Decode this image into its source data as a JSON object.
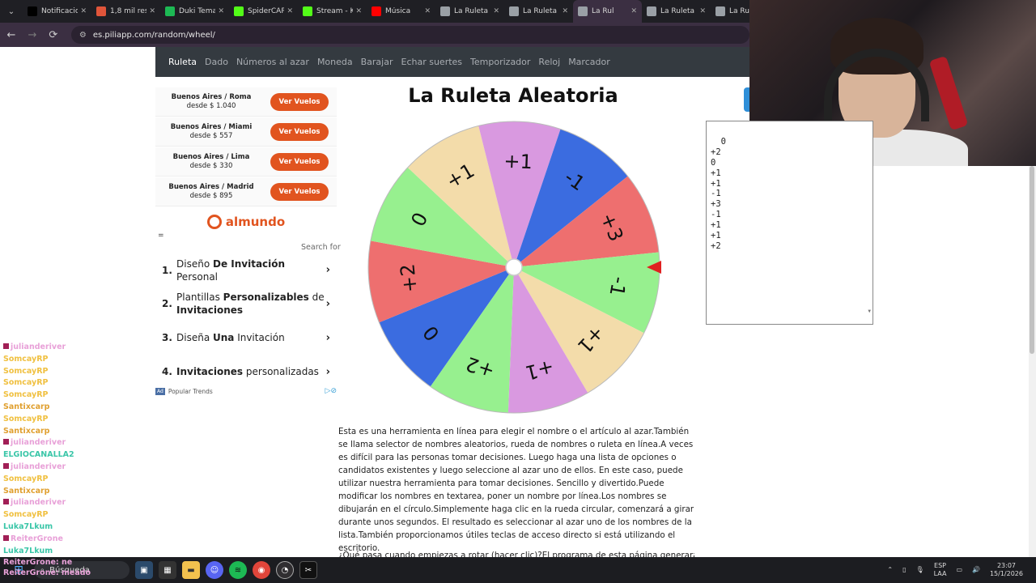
{
  "browser": {
    "tabs": [
      {
        "title": "Notificacio",
        "icon": "x-logo-icon",
        "color": "#000000"
      },
      {
        "title": "1,8 mil res",
        "icon": "bookmark-icon",
        "color": "#e0553a"
      },
      {
        "title": "Duki Tema",
        "icon": "spotify-icon",
        "color": "#1db954"
      },
      {
        "title": "SpiderCAR",
        "icon": "kick-icon",
        "color": "#53fc18"
      },
      {
        "title": "Stream - K",
        "icon": "kick-icon",
        "color": "#53fc18"
      },
      {
        "title": "Música",
        "icon": "youtube-icon",
        "color": "#ff0000"
      },
      {
        "title": "La Ruleta A",
        "icon": "globe-icon",
        "color": "#9aa0a6"
      },
      {
        "title": "La Ruleta A",
        "icon": "globe-icon",
        "color": "#9aa0a6"
      },
      {
        "title": "La Rul",
        "icon": "globe-icon",
        "color": "#9aa0a6",
        "active": true
      },
      {
        "title": "La Ruleta A",
        "icon": "globe-icon",
        "color": "#9aa0a6"
      },
      {
        "title": "La Rule",
        "icon": "globe-icon",
        "color": "#9aa0a6"
      }
    ],
    "url": "es.piliapp.com/random/wheel/"
  },
  "site_nav": [
    "Ruleta",
    "Dado",
    "Números al azar",
    "Moneda",
    "Barajar",
    "Echar suertes",
    "Temporizador",
    "Reloj",
    "Marcador"
  ],
  "ads": {
    "flights": [
      {
        "route": "Buenos Aires / Roma",
        "price": "desde $ 1.040",
        "button": "Ver Vuelos"
      },
      {
        "route": "Buenos Aires / Miami",
        "price": "desde $ 557",
        "button": "Ver Vuelos"
      },
      {
        "route": "Buenos Aires / Lima",
        "price": "desde $ 330",
        "button": "Ver Vuelos"
      },
      {
        "route": "Buenos Aires / Madrid",
        "price": "desde $ 895",
        "button": "Ver Vuelos"
      }
    ],
    "brand": "almundo",
    "equals": "=",
    "search_for": "Search for",
    "results": [
      {
        "num": "1.",
        "parts": [
          "Diseño ",
          "De Invitación",
          " Personal"
        ]
      },
      {
        "num": "2.",
        "parts": [
          "Plantillas ",
          "Personalizables",
          " de ",
          "Invitaciones"
        ]
      },
      {
        "num": "3.",
        "parts": [
          "Diseña ",
          "Una",
          " Invitación"
        ]
      },
      {
        "num": "4.",
        "parts": [
          "Invitaciones",
          " personalizadas"
        ]
      }
    ],
    "footer": "Popular Trends",
    "ad_label": "Ad"
  },
  "chat": [
    {
      "user": "julianderiver",
      "msg": "",
      "color": "#e8a1d8"
    },
    {
      "user": "SomcayRP",
      "msg": "",
      "color": "#f0c040"
    },
    {
      "user": "SomcayRP",
      "msg": "",
      "color": "#f0c040"
    },
    {
      "user": "SomcayRP",
      "msg": "",
      "color": "#f0c040"
    },
    {
      "user": "SomcayRP",
      "msg": "",
      "color": "#f0c040"
    },
    {
      "user": "Santixcarp",
      "msg": "",
      "color": "#e0a030"
    },
    {
      "user": "SomcayRP",
      "msg": "",
      "color": "#f0c040"
    },
    {
      "user": "Santixcarp",
      "msg": "",
      "color": "#e0a030"
    },
    {
      "user": "julianderiver",
      "msg": "",
      "color": "#e8a1d8"
    },
    {
      "user": "ELGIOCANALLA2",
      "msg": "",
      "color": "#3ac6a8"
    },
    {
      "user": "julianderiver",
      "msg": "",
      "color": "#e8a1d8"
    },
    {
      "user": "SomcayRP",
      "msg": "",
      "color": "#f0c040"
    },
    {
      "user": "Santixcarp",
      "msg": "",
      "color": "#e0a030"
    },
    {
      "user": "julianderiver",
      "msg": "",
      "color": "#e8a1d8"
    },
    {
      "user": "SomcayRP",
      "msg": "",
      "color": "#f0c040"
    },
    {
      "user": "Luka7Lkum",
      "msg": "",
      "color": "#3ac6a8"
    },
    {
      "user": "ReiterGrone",
      "msg": "",
      "color": "#e8a1d8"
    },
    {
      "user": "Luka7Lkum",
      "msg": "",
      "color": "#3ac6a8"
    }
  ],
  "overlay_lines": [
    "ReiterGrone: ne",
    "ReiterGrone: meado"
  ],
  "wheel": {
    "title": "La Ruleta Aleatoria",
    "segments": [
      {
        "label": "0",
        "color": "#3b6ce0"
      },
      {
        "label": "+2",
        "color": "#ee6f6f"
      },
      {
        "label": "0",
        "color": "#97f08f"
      },
      {
        "label": "+1",
        "color": "#f3dcaa"
      },
      {
        "label": "+1",
        "color": "#d999e0"
      },
      {
        "label": "-1",
        "color": "#3b6ce0"
      },
      {
        "label": "+3",
        "color": "#ee6f6f"
      },
      {
        "label": "-1",
        "color": "#97f08f"
      },
      {
        "label": "+1",
        "color": "#f3dcaa"
      },
      {
        "label": "+1",
        "color": "#d999e0"
      },
      {
        "label": "+2",
        "color": "#97f08f"
      }
    ],
    "pointer_color": "#e02020"
  },
  "names_list": "0\n+2\n0\n+1\n+1\n-1\n+3\n-1\n+1\n+1\n+2",
  "description": "Esta es una herramienta en línea para elegir el nombre o el artículo al azar.También se llama selector de nombres aleatorios, rueda de nombres o ruleta en línea.A veces es difícil para las personas tomar decisiones. Luego haga una lista de opciones o candidatos existentes y luego seleccione al azar uno de ellos. En este caso, puede utilizar nuestra herramienta para tomar decisiones. Sencillo y divertido.Puede modificar los nombres en textarea, poner un nombre por línea.Los nombres se dibujarán en el círculo.Simplemente haga clic en la rueda circular, comenzará a girar durante unos segundos. El resultado es seleccionar al azar uno de los nombres de la lista.También proporcionamos útiles teclas de acceso directo si está utilizando el escritorio.",
  "description2": "¿Qué pasa cuando empiezas a rotar (hacer clic)?El programa de esta página generará un",
  "taskbar": {
    "search": "Búsqueda",
    "lang": "ESP",
    "lang2": "LAA",
    "time": "23:07",
    "date": "15/1/2026"
  }
}
